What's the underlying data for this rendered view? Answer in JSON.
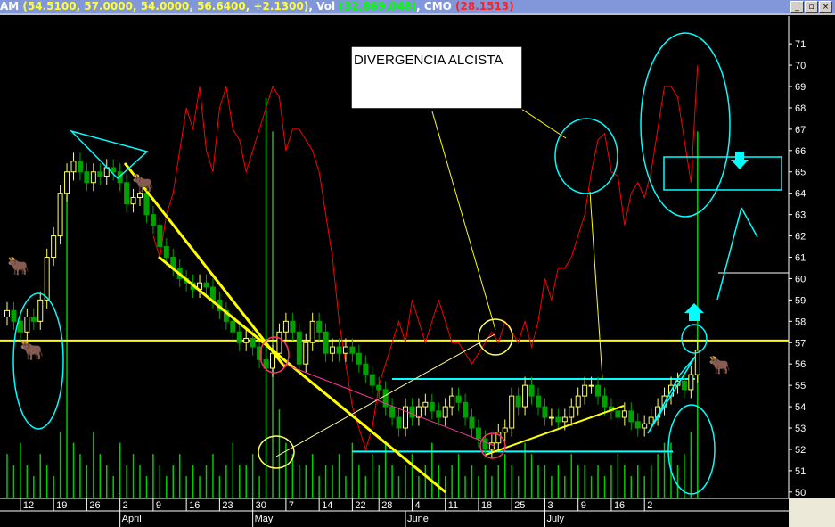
{
  "header": {
    "symbol_tail": "AM",
    "ohlc": "(54.5100, 57.0000, 54.0000, 56.6400, +2.1300)",
    "vol_label": "Vol",
    "vol_value": "(32,869,048)",
    "cmo_label": "CMO",
    "cmo_value": "(28.1513)"
  },
  "window_buttons": {
    "minimize": "_",
    "restore": "▫",
    "close": "×"
  },
  "annotation": {
    "title": "DIVERGENCIA ALCISTA"
  },
  "chart_data": {
    "type": "candlestick",
    "title": "",
    "y_ticks": [
      50,
      51,
      52,
      53,
      54,
      55,
      56,
      57,
      58,
      59,
      60,
      61,
      62,
      63,
      64,
      65,
      66,
      67,
      68,
      69,
      70,
      71
    ],
    "ylim": [
      49.7,
      72.3
    ],
    "x_ticks": [
      {
        "label": "12",
        "i": 2
      },
      {
        "label": "19",
        "i": 7
      },
      {
        "label": "26",
        "i": 12
      },
      {
        "label": "2",
        "i": 17
      },
      {
        "label": "9",
        "i": 22
      },
      {
        "label": "16",
        "i": 27
      },
      {
        "label": "23",
        "i": 32
      },
      {
        "label": "30",
        "i": 37
      },
      {
        "label": "7",
        "i": 42
      },
      {
        "label": "14",
        "i": 47
      },
      {
        "label": "22",
        "i": 52
      },
      {
        "label": "28",
        "i": 56
      },
      {
        "label": "4",
        "i": 61
      },
      {
        "label": "11",
        "i": 66
      },
      {
        "label": "18",
        "i": 71
      },
      {
        "label": "25",
        "i": 76
      },
      {
        "label": "3",
        "i": 81
      },
      {
        "label": "9",
        "i": 86
      },
      {
        "label": "16",
        "i": 91
      },
      {
        "label": "2",
        "i": 96
      }
    ],
    "months": [
      {
        "label": "April",
        "i": 17
      },
      {
        "label": "May",
        "i": 37
      },
      {
        "label": "June",
        "i": 60
      },
      {
        "label": "July",
        "i": 81
      }
    ],
    "closes": [
      58.5,
      58,
      57.5,
      58.2,
      58,
      59,
      61,
      62,
      64,
      65,
      65.5,
      65,
      64.5,
      65,
      64.8,
      65.2,
      65,
      64.5,
      63.5,
      63.8,
      64,
      63,
      62.5,
      61.5,
      61,
      60.5,
      60,
      59.8,
      59.5,
      59.8,
      59.6,
      59,
      58.5,
      58,
      57.5,
      57,
      57.2,
      56.8,
      56.2,
      55.8,
      56.5,
      57.5,
      58,
      57.5,
      56,
      57,
      58,
      57.5,
      56.5,
      56.8,
      56.5,
      56.8,
      56.5,
      56,
      55.5,
      55,
      54.8,
      54,
      53.5,
      53,
      54,
      53.5,
      54,
      54.2,
      53.8,
      53.5,
      54,
      54.5,
      54.2,
      53.5,
      53,
      52.5,
      52,
      52.3,
      52.8,
      53,
      54.5,
      54,
      55,
      54.5,
      54,
      53.5,
      53.5,
      53.3,
      53.5,
      54,
      54.5,
      55,
      55,
      54.5,
      54,
      53.8,
      53.5,
      53.8,
      53.3,
      53,
      53.2,
      53.5,
      54,
      54.5,
      55,
      55.2,
      54.8,
      55.5,
      56.64
    ],
    "volume_millions": [
      4,
      3,
      5,
      3,
      2,
      4,
      3,
      2,
      6,
      28,
      5,
      4,
      3,
      6,
      4,
      3,
      2,
      5,
      3,
      4,
      3,
      2,
      4,
      3,
      2,
      3,
      4,
      2,
      3,
      2,
      3,
      4,
      2,
      3,
      5,
      3,
      3,
      4,
      2,
      36,
      33,
      8,
      5,
      4,
      3,
      3,
      4,
      2,
      3,
      3,
      4,
      2,
      5,
      3,
      2,
      4,
      3,
      5,
      3,
      2,
      3,
      4,
      2,
      3,
      5,
      3,
      2,
      3,
      4,
      2,
      3,
      2,
      3,
      2,
      3,
      4,
      3,
      2,
      5,
      4,
      3,
      3,
      2,
      3,
      2,
      4,
      3,
      3,
      2,
      3,
      2,
      3,
      4,
      3,
      2,
      3,
      2,
      3,
      4,
      5,
      5,
      3,
      4,
      6,
      33
    ],
    "cmo_series": [
      62,
      61,
      63,
      64,
      66,
      68,
      67,
      69,
      66,
      65,
      68,
      69,
      67,
      66.5,
      65,
      66,
      67,
      68,
      69,
      68.5,
      66,
      67,
      67,
      66.5,
      66,
      65,
      63,
      61,
      58,
      56,
      54,
      53,
      52,
      53,
      55,
      56,
      57,
      58,
      57,
      59,
      58,
      57,
      58,
      59,
      58,
      57,
      57,
      56.5,
      56,
      56.5,
      57,
      57.5,
      57,
      58,
      57.5,
      57,
      58,
      56.8,
      58,
      60,
      59,
      60.5,
      60.5,
      61,
      62,
      63,
      65,
      66.5,
      66.8,
      65,
      64.8,
      62.5,
      64,
      64.5,
      63.8,
      65,
      67,
      69,
      69,
      68.5,
      66.5,
      64.5,
      70
    ],
    "cmo_start_index": 22,
    "series_colors": {
      "up": "#ffff66",
      "down": "#00a000",
      "volume": "#00cc00",
      "cmo": "#ff0000"
    },
    "horizontal_lines": [
      {
        "value": 57.1,
        "color": "#ffff00"
      },
      {
        "value": 55.3,
        "color": "#00ffff"
      },
      {
        "value": 51.9,
        "color": "#00ffff"
      }
    ]
  }
}
